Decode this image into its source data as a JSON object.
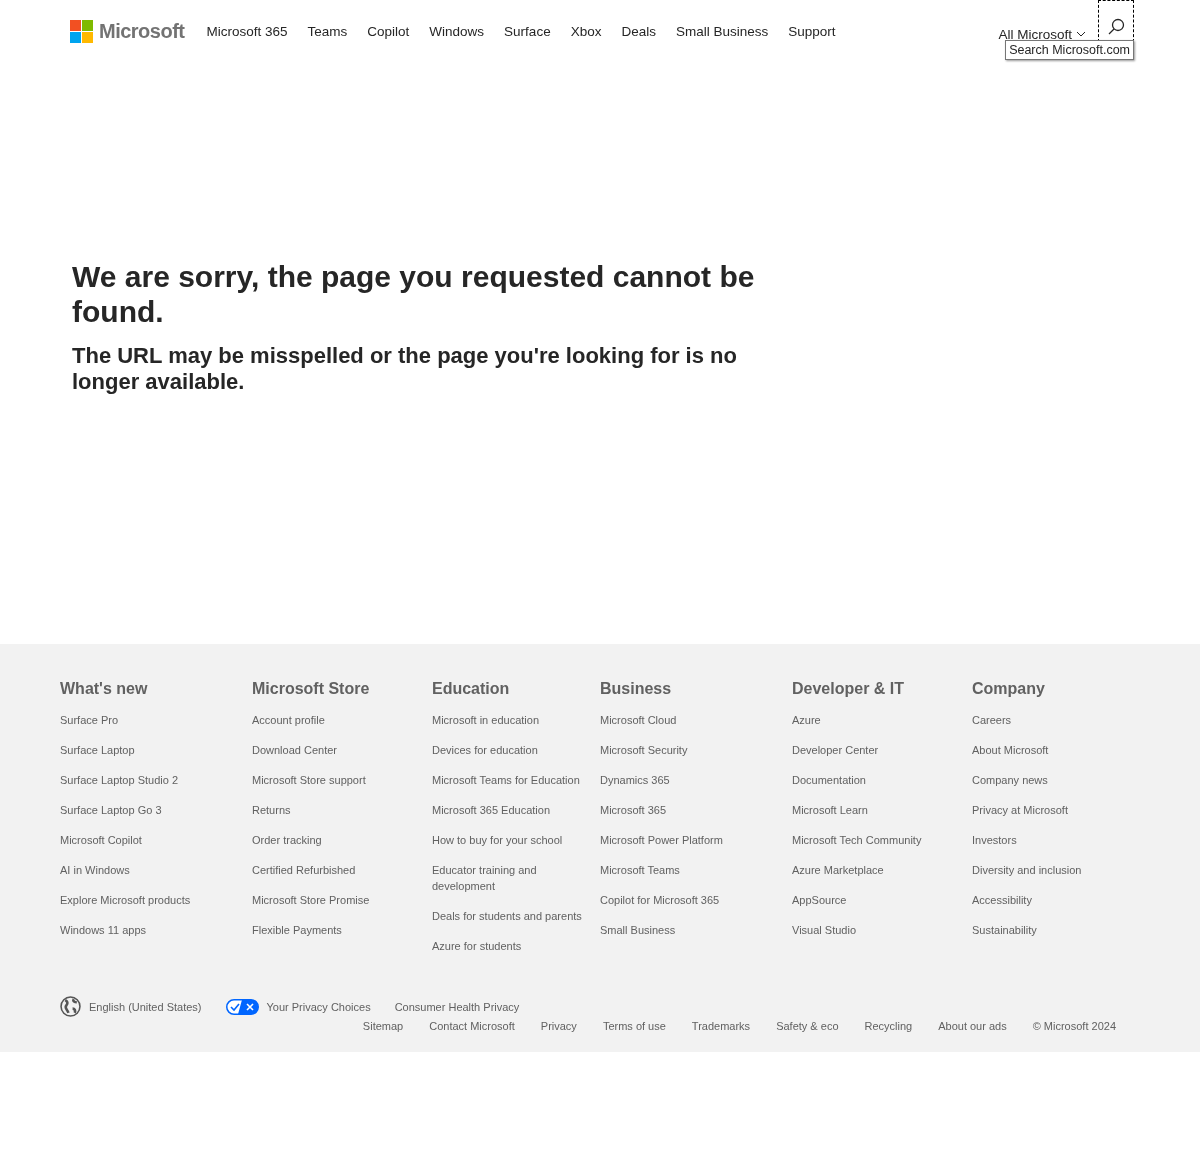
{
  "header": {
    "logo": "Microsoft",
    "nav": [
      "Microsoft 365",
      "Teams",
      "Copilot",
      "Windows",
      "Surface",
      "Xbox",
      "Deals",
      "Small Business",
      "Support"
    ],
    "all_menu": "All Microsoft",
    "search_tooltip": "Search Microsoft.com"
  },
  "main": {
    "title": "We are sorry, the page you requested cannot be found.",
    "subtitle": "The URL may be misspelled or the page you're looking for is no longer available."
  },
  "footer": {
    "columns": [
      {
        "heading": "What's new",
        "links": [
          "Surface Pro",
          "Surface Laptop",
          "Surface Laptop Studio 2",
          "Surface Laptop Go 3",
          "Microsoft Copilot",
          "AI in Windows",
          "Explore Microsoft products",
          "Windows 11 apps"
        ]
      },
      {
        "heading": "Microsoft Store",
        "links": [
          "Account profile",
          "Download Center",
          "Microsoft Store support",
          "Returns",
          "Order tracking",
          "Certified Refurbished",
          "Microsoft Store Promise",
          "Flexible Payments"
        ]
      },
      {
        "heading": "Education",
        "links": [
          "Microsoft in education",
          "Devices for education",
          "Microsoft Teams for Education",
          "Microsoft 365 Education",
          "How to buy for your school",
          "Educator training and development",
          "Deals for students and parents",
          "Azure for students"
        ]
      },
      {
        "heading": "Business",
        "links": [
          "Microsoft Cloud",
          "Microsoft Security",
          "Dynamics 365",
          "Microsoft 365",
          "Microsoft Power Platform",
          "Microsoft Teams",
          "Copilot for Microsoft 365",
          "Small Business"
        ]
      },
      {
        "heading": "Developer & IT",
        "links": [
          "Azure",
          "Developer Center",
          "Documentation",
          "Microsoft Learn",
          "Microsoft Tech Community",
          "Azure Marketplace",
          "AppSource",
          "Visual Studio"
        ]
      },
      {
        "heading": "Company",
        "links": [
          "Careers",
          "About Microsoft",
          "Company news",
          "Privacy at Microsoft",
          "Investors",
          "Diversity and inclusion",
          "Accessibility",
          "Sustainability"
        ]
      }
    ],
    "locale": "English (United States)",
    "privacy_choices": "Your Privacy Choices",
    "consumer_health": "Consumer Health Privacy",
    "legal_links": [
      "Sitemap",
      "Contact Microsoft",
      "Privacy",
      "Terms of use",
      "Trademarks",
      "Safety & eco",
      "Recycling",
      "About our ads"
    ],
    "copyright": "© Microsoft 2024"
  }
}
